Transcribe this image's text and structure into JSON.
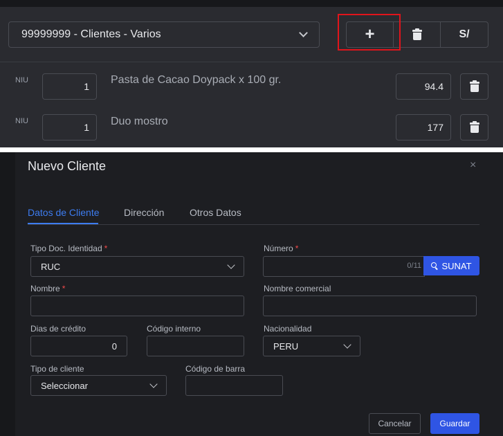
{
  "top": {
    "client_select": "99999999 - Clientes - Varios",
    "add_label": "+",
    "currency_label": "S/",
    "items": [
      {
        "unit": "NIU",
        "qty": "1",
        "name": "Pasta de Cacao Doypack x 100 gr.",
        "price": "94.4"
      },
      {
        "unit": "NIU",
        "qty": "1",
        "name": "Duo mostro",
        "price": "177"
      }
    ]
  },
  "modal": {
    "title": "Nuevo Cliente",
    "close": "×",
    "tabs": [
      {
        "label": "Datos de Cliente",
        "active": true
      },
      {
        "label": "Dirección",
        "active": false
      },
      {
        "label": "Otros Datos",
        "active": false
      }
    ],
    "fields": {
      "tipo_doc": {
        "label": "Tipo Doc. Identidad",
        "required": "*",
        "value": "RUC"
      },
      "numero": {
        "label": "Número",
        "required": "*",
        "value": "",
        "counter": "0/11"
      },
      "sunat": {
        "label": "SUNAT"
      },
      "nombre": {
        "label": "Nombre",
        "required": "*",
        "value": ""
      },
      "nombre_comercial": {
        "label": "Nombre comercial",
        "value": ""
      },
      "dias_credito": {
        "label": "Dias de crédito",
        "value": "0"
      },
      "codigo_interno": {
        "label": "Código interno",
        "value": ""
      },
      "nacionalidad": {
        "label": "Nacionalidad",
        "value": "PERU"
      },
      "tipo_cliente": {
        "label": "Tipo de cliente",
        "value": "Seleccionar"
      },
      "codigo_barra": {
        "label": "Código de barra",
        "value": ""
      }
    },
    "cancel_label": "Cancelar",
    "save_label": "Guardar"
  },
  "colors": {
    "accent": "#2f55e4",
    "active_tab": "#3d7cf0",
    "required": "#f04a4a",
    "highlight": "#e1141b"
  }
}
